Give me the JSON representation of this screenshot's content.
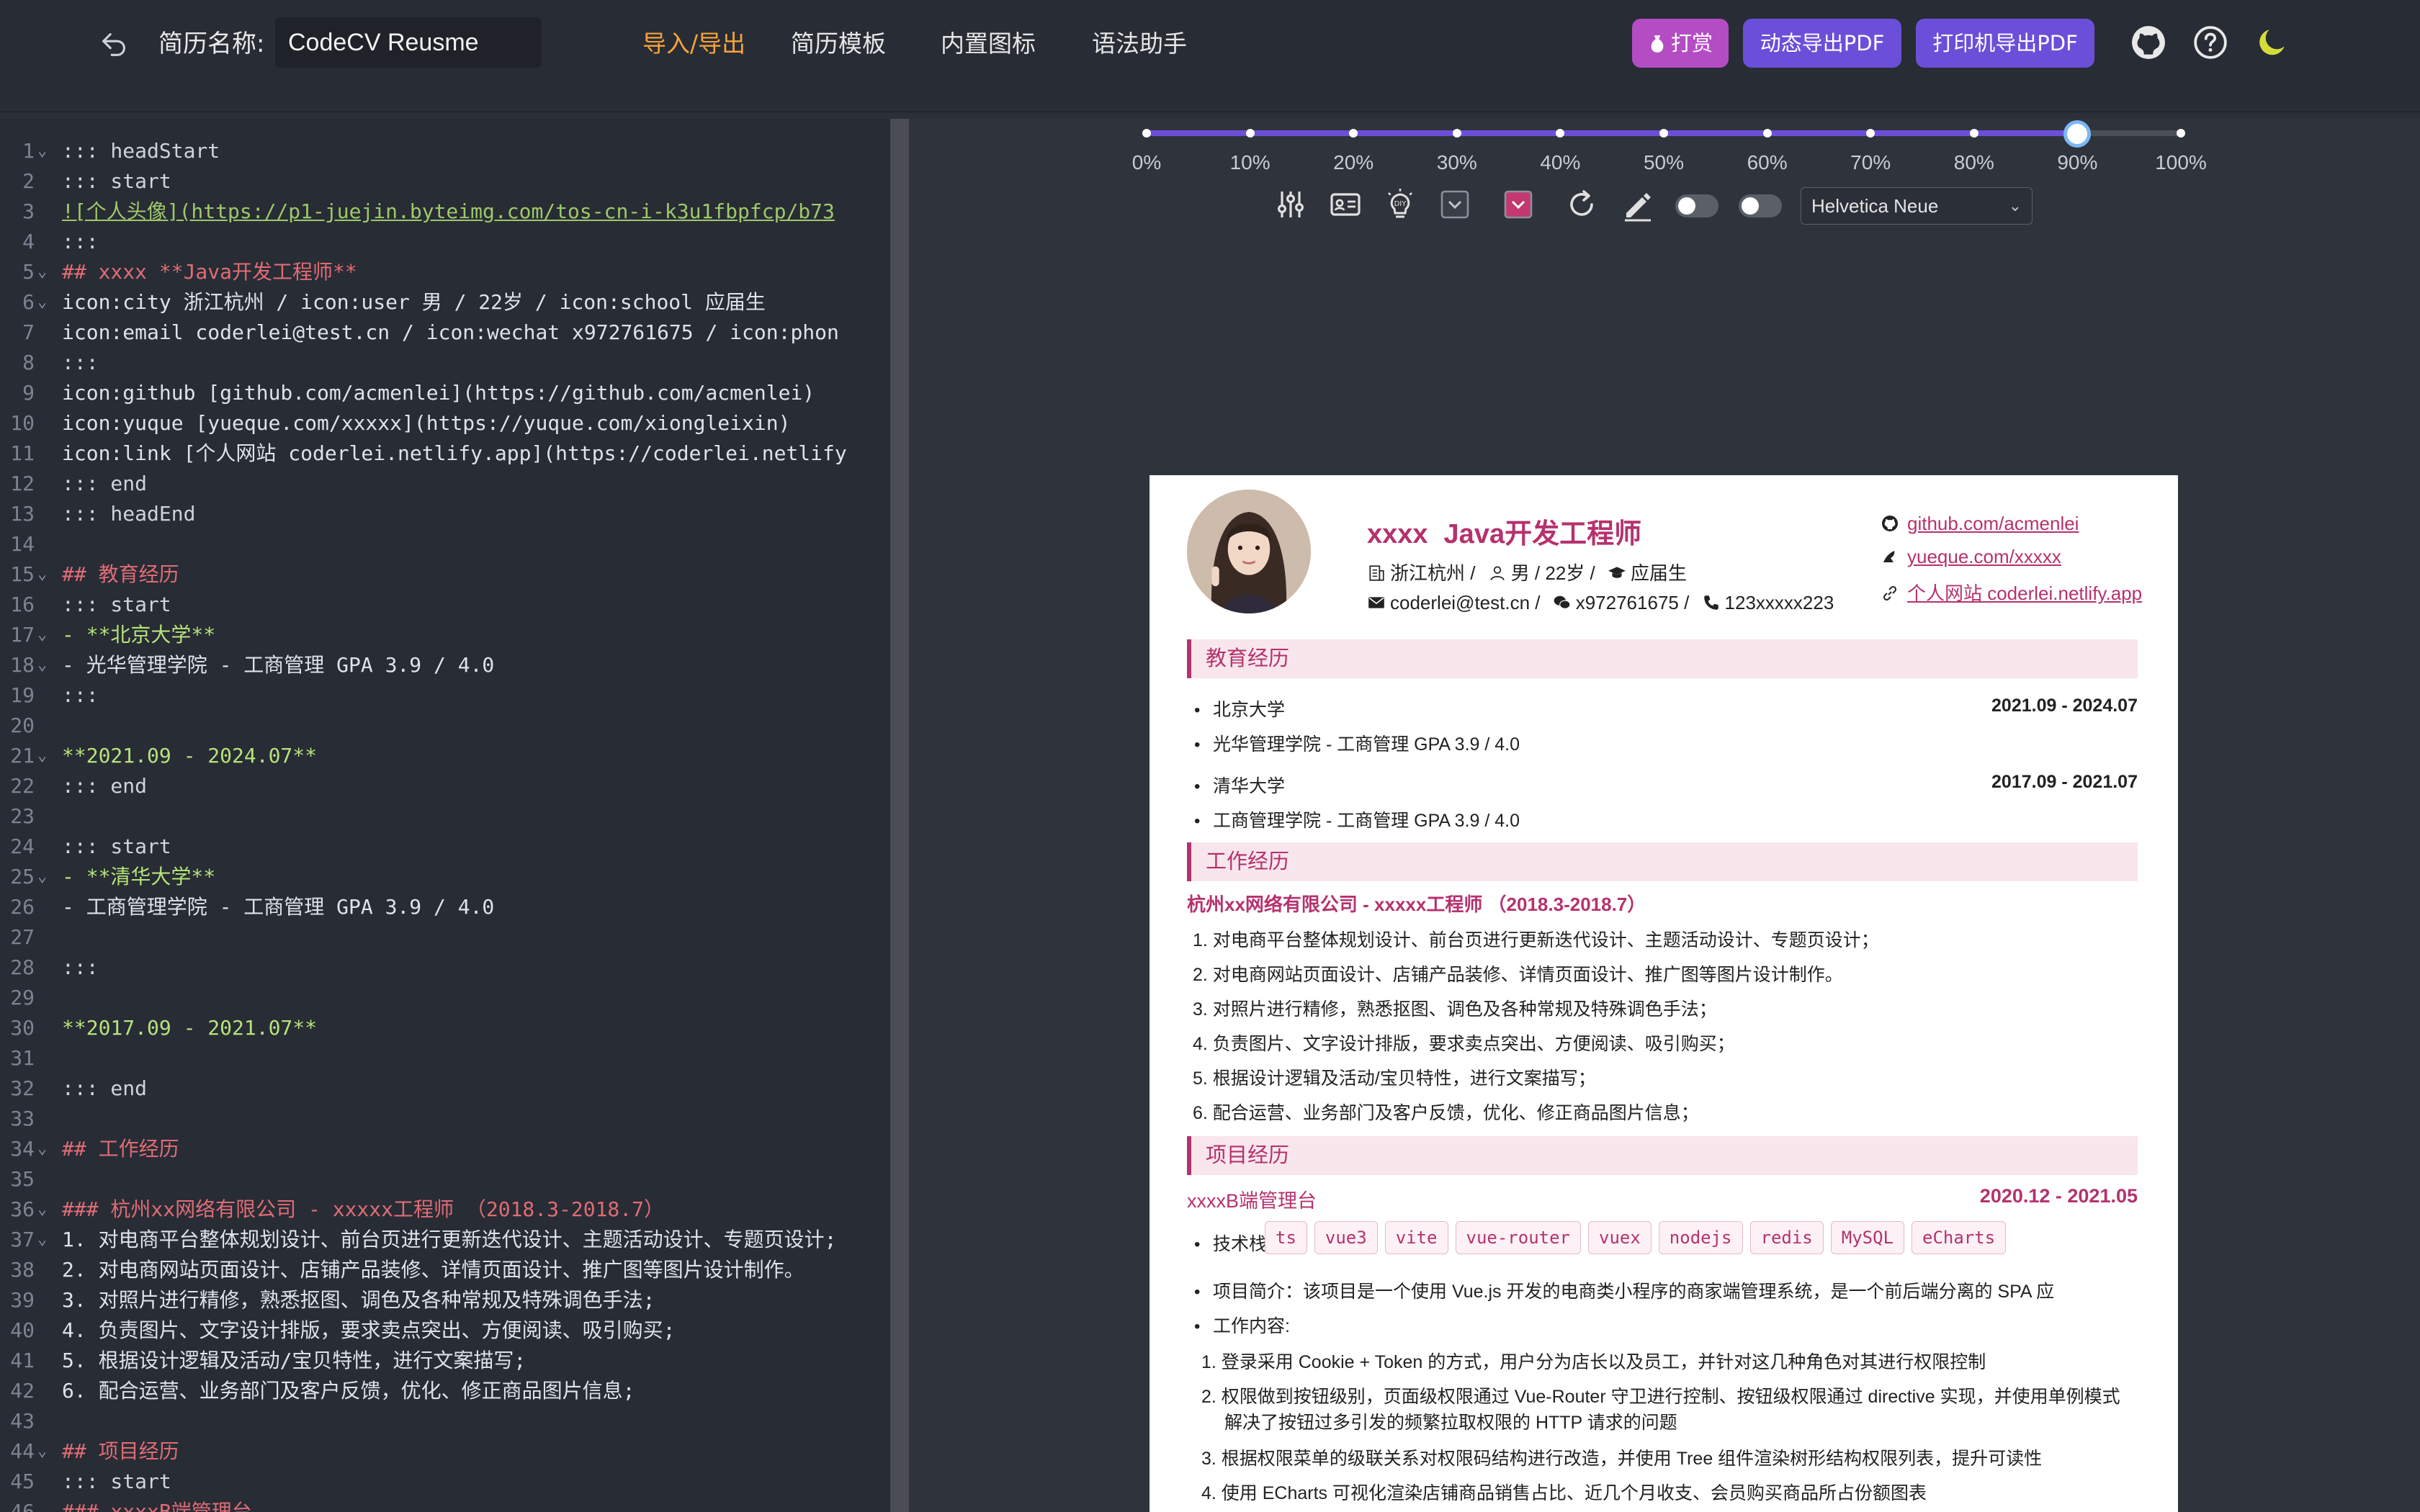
{
  "topbar": {
    "name_label": "简历名称:",
    "name_value": "CodeCV Reusme",
    "nav": [
      "导入/导出",
      "简历模板",
      "内置图标",
      "语法助手"
    ],
    "donate_label": "打赏",
    "dynamic_pdf_label": "动态导出PDF",
    "print_pdf_label": "打印机导出PDF"
  },
  "editor": {
    "lines": [
      {
        "n": "1",
        "fold": true,
        "t": "::: headStart",
        "c": "muted"
      },
      {
        "n": "2",
        "fold": false,
        "t": "::: start",
        "c": "muted"
      },
      {
        "n": "3",
        "fold": false,
        "t": "![个人头像](https://p1-juejin.byteimg.com/tos-cn-i-k3u1fbpfcp/b73",
        "c": "link"
      },
      {
        "n": "4",
        "fold": false,
        "t": ":::",
        "c": "muted"
      },
      {
        "n": "5",
        "fold": true,
        "t": "## xxxx **Java开发工程师**",
        "c": "heading"
      },
      {
        "n": "6",
        "fold": true,
        "t": "icon:city 浙江杭州 / icon:user 男 / 22岁 / icon:school 应届生",
        "c": "plain"
      },
      {
        "n": "7",
        "fold": false,
        "t": "icon:email coderlei@test.cn / icon:wechat x972761675 / icon:phon",
        "c": "plain"
      },
      {
        "n": "8",
        "fold": false,
        "t": ":::",
        "c": "muted"
      },
      {
        "n": "9",
        "fold": false,
        "t": "icon:github [github.com/acmenlei](https://github.com/acmenlei)",
        "c": "plainlink"
      },
      {
        "n": "10",
        "fold": false,
        "t": "icon:yuque [yueque.com/xxxxx](https://yuque.com/xiongleixin)",
        "c": "plainlink"
      },
      {
        "n": "11",
        "fold": false,
        "t": "icon:link [个人网站 coderlei.netlify.app](https://coderlei.netlify",
        "c": "plainlink"
      },
      {
        "n": "12",
        "fold": false,
        "t": "::: end",
        "c": "muted"
      },
      {
        "n": "13",
        "fold": false,
        "t": "::: headEnd",
        "c": "muted"
      },
      {
        "n": "14",
        "fold": false,
        "t": "",
        "c": "muted"
      },
      {
        "n": "15",
        "fold": true,
        "t": "## 教育经历",
        "c": "heading"
      },
      {
        "n": "16",
        "fold": false,
        "t": "::: start",
        "c": "muted"
      },
      {
        "n": "17",
        "fold": true,
        "t": "- **北京大学**",
        "c": "boldlist"
      },
      {
        "n": "18",
        "fold": true,
        "t": "- 光华管理学院 - 工商管理 GPA 3.9 / 4.0",
        "c": "list"
      },
      {
        "n": "19",
        "fold": false,
        "t": ":::",
        "c": "muted"
      },
      {
        "n": "20",
        "fold": false,
        "t": "",
        "c": "muted"
      },
      {
        "n": "21",
        "fold": true,
        "t": "**2021.09 - 2024.07**",
        "c": "bold"
      },
      {
        "n": "22",
        "fold": false,
        "t": "::: end",
        "c": "muted"
      },
      {
        "n": "23",
        "fold": false,
        "t": "",
        "c": "muted"
      },
      {
        "n": "24",
        "fold": false,
        "t": "::: start",
        "c": "muted"
      },
      {
        "n": "25",
        "fold": true,
        "t": "- **清华大学**",
        "c": "boldlist"
      },
      {
        "n": "26",
        "fold": false,
        "t": "- 工商管理学院 - 工商管理 GPA 3.9 / 4.0",
        "c": "list"
      },
      {
        "n": "27",
        "fold": false,
        "t": "",
        "c": "muted"
      },
      {
        "n": "28",
        "fold": false,
        "t": ":::",
        "c": "muted"
      },
      {
        "n": "29",
        "fold": false,
        "t": "",
        "c": "muted"
      },
      {
        "n": "30",
        "fold": false,
        "t": "**2017.09 - 2021.07**",
        "c": "bold"
      },
      {
        "n": "31",
        "fold": false,
        "t": "",
        "c": "muted"
      },
      {
        "n": "32",
        "fold": false,
        "t": "::: end",
        "c": "muted"
      },
      {
        "n": "33",
        "fold": false,
        "t": "",
        "c": "muted"
      },
      {
        "n": "34",
        "fold": true,
        "t": "## 工作经历",
        "c": "heading"
      },
      {
        "n": "35",
        "fold": false,
        "t": "",
        "c": "muted"
      },
      {
        "n": "36",
        "fold": true,
        "t": "### 杭州xx网络有限公司 - xxxxx工程师 （2018.3-2018.7）",
        "c": "heading"
      },
      {
        "n": "37",
        "fold": true,
        "t": "1. 对电商平台整体规划设计、前台页进行更新迭代设计、主题活动设计、专题页设计;",
        "c": "olist"
      },
      {
        "n": "38",
        "fold": false,
        "t": "2. 对电商网站页面设计、店铺产品装修、详情页面设计、推广图等图片设计制作。",
        "c": "olist"
      },
      {
        "n": "39",
        "fold": false,
        "t": "3. 对照片进行精修，熟悉抠图、调色及各种常规及特殊调色手法;",
        "c": "olist"
      },
      {
        "n": "40",
        "fold": false,
        "t": "4. 负责图片、文字设计排版，要求卖点突出、方便阅读、吸引购买;",
        "c": "olist"
      },
      {
        "n": "41",
        "fold": false,
        "t": "5. 根据设计逻辑及活动/宝贝特性，进行文案描写;",
        "c": "olist"
      },
      {
        "n": "42",
        "fold": false,
        "t": "6. 配合运营、业务部门及客户反馈，优化、修正商品图片信息;",
        "c": "olist"
      },
      {
        "n": "43",
        "fold": false,
        "t": "",
        "c": "muted"
      },
      {
        "n": "44",
        "fold": true,
        "t": "## 项目经历",
        "c": "heading"
      },
      {
        "n": "45",
        "fold": false,
        "t": "::: start",
        "c": "muted"
      },
      {
        "n": "46",
        "fold": true,
        "t": "### xxxxB端管理台",
        "c": "heading"
      }
    ]
  },
  "scale": {
    "value_percent": 90,
    "labels": [
      "0%",
      "10%",
      "20%",
      "30%",
      "40%",
      "50%",
      "60%",
      "70%",
      "80%",
      "90%",
      "100%"
    ]
  },
  "font_select": {
    "value": "Helvetica Neue"
  },
  "resume": {
    "name": "xxxx",
    "title": "Java开发工程师",
    "info1": {
      "city": "浙江杭州 /",
      "user": "男 / 22岁 /",
      "school": "应届生"
    },
    "info2": {
      "email": "coderlei@test.cn /",
      "wechat": "x972761675 /",
      "phone": "123xxxxx223"
    },
    "links": [
      "github.com/acmenlei",
      "yueque.com/xxxxx",
      "个人网站 coderlei.netlify.app"
    ],
    "edu_title": "教育经历",
    "edu": [
      {
        "school": "北京大学",
        "date": "2021.09 - 2024.07",
        "detail": "光华管理学院 - 工商管理 GPA 3.9 / 4.0"
      },
      {
        "school": "清华大学",
        "date": "2017.09 - 2021.07",
        "detail": "工商管理学院 - 工商管理 GPA 3.9 / 4.0"
      }
    ],
    "work_title": "工作经历",
    "work_company": "杭州xx网络有限公司 - xxxxx工程师  （2018.3-2018.7）",
    "work_items": [
      "1. 对电商平台整体规划设计、前台页进行更新迭代设计、主题活动设计、专题页设计；",
      "2. 对电商网站页面设计、店铺产品装修、详情页面设计、推广图等图片设计制作。",
      "3. 对照片进行精修，熟悉抠图、调色及各种常规及特殊调色手法；",
      "4. 负责图片、文字设计排版，要求卖点突出、方便阅读、吸引购买；",
      "5. 根据设计逻辑及活动/宝贝特性，进行文案描写；",
      "6. 配合运营、业务部门及客户反馈，优化、修正商品图片信息；"
    ],
    "proj_title": "项目经历",
    "proj_name": "xxxxB端管理台",
    "proj_date": "2020.12 - 2021.05",
    "tech_label": "技术栈:",
    "tech": [
      "ts",
      "vue3",
      "vite",
      "vue-router",
      "vuex",
      "nodejs",
      "redis",
      "MySQL",
      "eCharts"
    ],
    "proj_intro": "项目简介：该项目是一个使用 Vue.js 开发的电商类小程序的商家端管理系统，是一个前后端分离的 SPA 应",
    "proj_work_label": "工作内容:",
    "proj_items": [
      "1. 登录采用 Cookie + Token 的方式，用户分为店长以及员工，并针对这几种角色对其进行权限控制",
      "2. 权限做到按钮级别，页面级权限通过 Vue-Router 守卫进行控制、按钮级权限通过 directive 实现，并使用单例模式",
      "解决了按钮过多引发的频繁拉取权限的 HTTP 请求的问题",
      "3. 根据权限菜单的级联关系对权限码结构进行改造，并使用 Tree 组件渲染树形结构权限列表，提升可读性",
      "4. 使用 ECharts 可视化渲染店铺商品销售占比、近几个月收支、会员购买商品所占份额图表"
    ]
  }
}
